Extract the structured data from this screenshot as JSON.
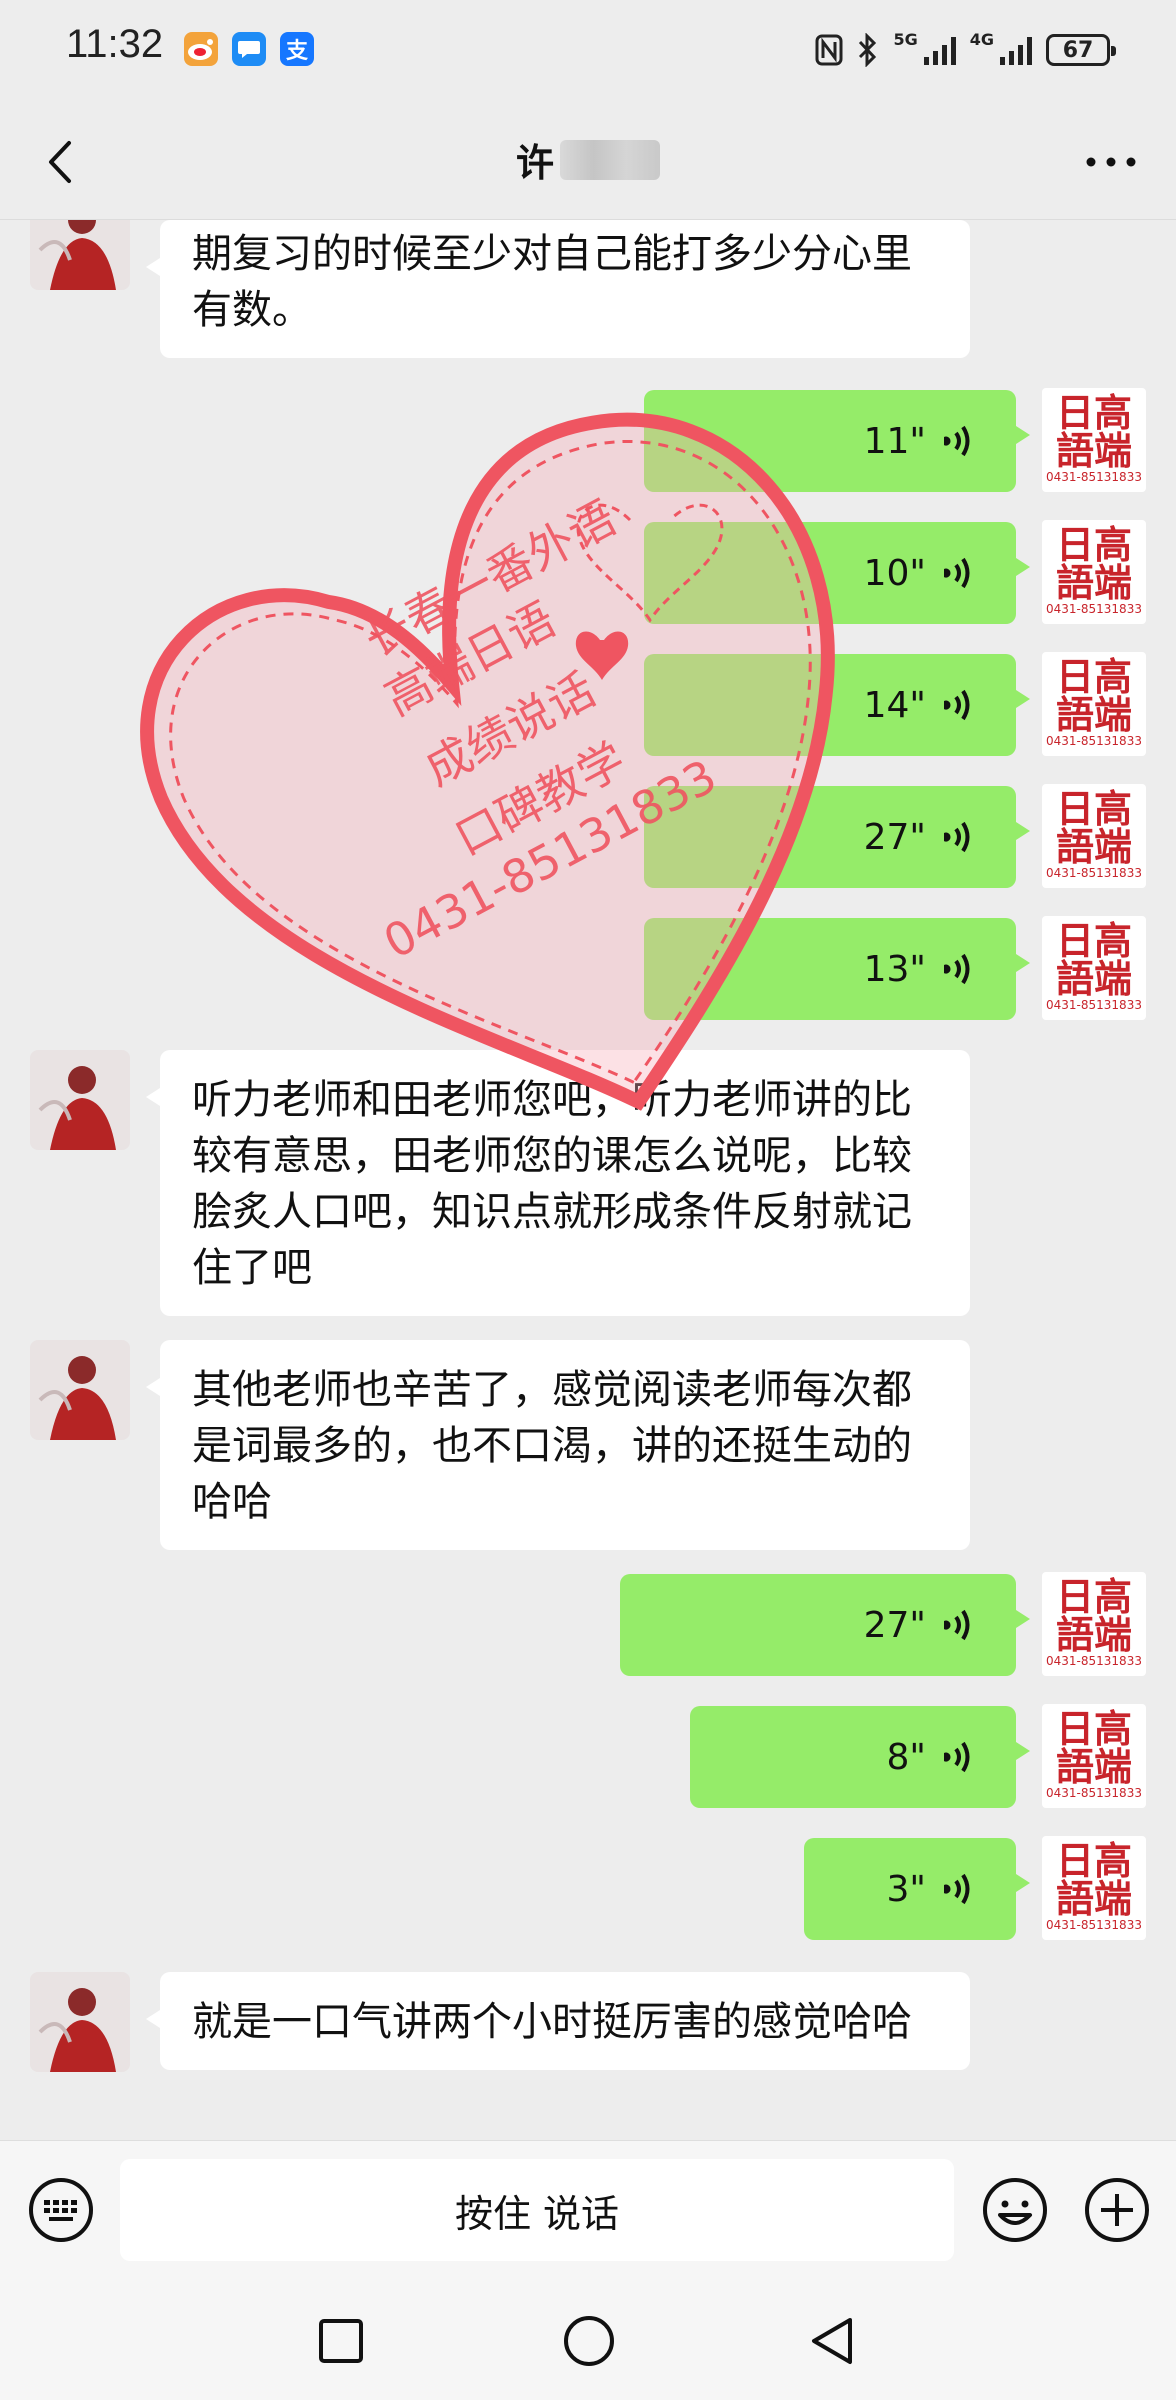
{
  "status": {
    "time": "11:32",
    "apps": [
      {
        "icon": "weibo-icon",
        "glyph": "微",
        "color": "#f3a33b"
      },
      {
        "icon": "message-icon",
        "glyph": "…",
        "color": "#1e8cf5"
      },
      {
        "icon": "alipay-icon",
        "glyph": "支",
        "color": "#1677ff"
      }
    ],
    "net1": "5G",
    "net2": "4G",
    "battery": "67"
  },
  "header": {
    "title": "许"
  },
  "messages": {
    "m1": "期复习的时候至少对自己能打多少分心里有数。",
    "v1": "11\"",
    "v2": "10\"",
    "v3": "14\"",
    "v4": "27\"",
    "v5": "13\"",
    "m2": "听力老师和田老师您吧，听力老师讲的比较有意思，田老师您的课怎么说呢，比较脍炙人口吧，知识点就形成条件反射就记住了吧",
    "m3": "其他老师也辛苦了，感觉阅读老师每次都是词最多的，也不口渴，讲的还挺生动的哈哈",
    "v6": "27\"",
    "v7": "8\"",
    "v8": "3\"",
    "m4": "就是一口气讲两个小时挺厉害的感觉哈哈"
  },
  "self_avatar": {
    "line1": "日高",
    "line2": "語端",
    "phone": "0431-85131833"
  },
  "watermark": {
    "line1": "长春一番外语",
    "line2": "高端日语",
    "line3": "成绩说话",
    "line4": "口碑教学",
    "line5": "0431-85131833"
  },
  "input": {
    "talk_label": "按住 说话"
  },
  "colors": {
    "voice_bubble": "#95ec69",
    "incoming_bubble": "#ffffff",
    "background": "#ededed",
    "watermark": "#ef5561"
  }
}
